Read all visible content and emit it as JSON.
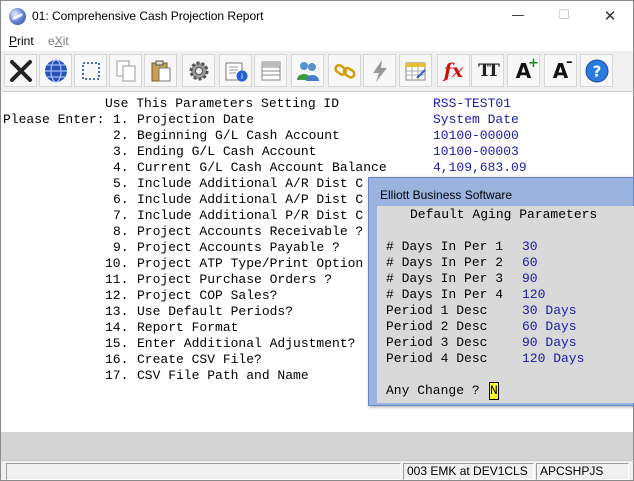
{
  "window": {
    "title": "01: Comprehensive Cash Projection Report",
    "minimize_glyph": "—",
    "maximize_glyph": "☐",
    "close_glyph": "✕"
  },
  "menu": {
    "print_first": "P",
    "print_rest": "rint",
    "exit_first": "e",
    "exit_mid": "X",
    "exit_rest": "it"
  },
  "toolbar": {
    "icons": [
      "close-x-icon",
      "globe-icon",
      "selection-icon",
      "copy-icon",
      "paste-icon",
      "settings-icon",
      "properties-icon",
      "list-icon",
      "users-icon",
      "chain-link-icon",
      "lightning-icon",
      "spreadsheet-icon",
      "function-icon",
      "font-icon",
      "font-increase-icon",
      "font-decrease-icon",
      "help-icon"
    ],
    "fx_label": "fx",
    "tt_label": "TT",
    "font_plus_label": "A",
    "font_minus_label": "A",
    "help_label": "?"
  },
  "form": {
    "setting_id_label": "Use This Parameters Setting ID",
    "setting_id_value": "RSS-TEST01",
    "please_enter": "Please Enter:",
    "items": [
      {
        "num": "1.",
        "label": "Projection Date",
        "value": "System Date"
      },
      {
        "num": "2.",
        "label": "Beginning G/L Cash Account",
        "value": "10100-00000"
      },
      {
        "num": "3.",
        "label": "Ending G/L Cash Account",
        "value": "10100-00003"
      },
      {
        "num": "4.",
        "label": "Current G/L Cash Account Balance",
        "value": "4,109,683.09"
      },
      {
        "num": "5.",
        "label": "Include Additional A/R Dist C",
        "value": ""
      },
      {
        "num": "6.",
        "label": "Include Additional A/P Dist C",
        "value": ""
      },
      {
        "num": "7.",
        "label": "Include Additional P/R Dist C",
        "value": ""
      },
      {
        "num": "8.",
        "label": "Project Accounts Receivable ?",
        "value": ""
      },
      {
        "num": "9.",
        "label": "Project Accounts Payable ?",
        "value": ""
      },
      {
        "num": "10.",
        "label": "Project ATP Type/Print Option",
        "value": ""
      },
      {
        "num": "11.",
        "label": "Project Purchase Orders ?",
        "value": ""
      },
      {
        "num": "12.",
        "label": "Project COP Sales?",
        "value": ""
      },
      {
        "num": "13.",
        "label": "Use Default Periods?",
        "value": ""
      },
      {
        "num": "14.",
        "label": "Report Format",
        "value": ""
      },
      {
        "num": "15.",
        "label": "Enter Additional Adjustment?",
        "value": ""
      },
      {
        "num": "16.",
        "label": "Create CSV File?",
        "value": ""
      },
      {
        "num": "17.",
        "label": "CSV File Path and Name",
        "value": ""
      }
    ]
  },
  "dialog": {
    "title": "Elliott Business Software",
    "heading": "Default Aging Parameters",
    "rows": [
      {
        "label": "# Days In Per 1",
        "value": "30"
      },
      {
        "label": "# Days In Per 2",
        "value": "60"
      },
      {
        "label": "# Days In Per 3",
        "value": "90"
      },
      {
        "label": "# Days In Per 4",
        "value": "120"
      },
      {
        "label": "Period 1 Desc",
        "value": "30 Days"
      },
      {
        "label": "Period 2 Desc",
        "value": "60 Days"
      },
      {
        "label": "Period 3 Desc",
        "value": "90 Days"
      },
      {
        "label": "Period 4 Desc",
        "value": "120 Days"
      }
    ],
    "prompt": "Any Change ?",
    "answer": "N"
  },
  "status": {
    "cell1": "",
    "cell2": "003 EMK at DEV1CLS",
    "cell3": "APCSHPJS"
  },
  "colors": {
    "value_text": "#1a1aa6",
    "dialog_frame": "#9bb4df",
    "dialog_body": "#d9d9d9",
    "cursor": "#ffff33"
  }
}
